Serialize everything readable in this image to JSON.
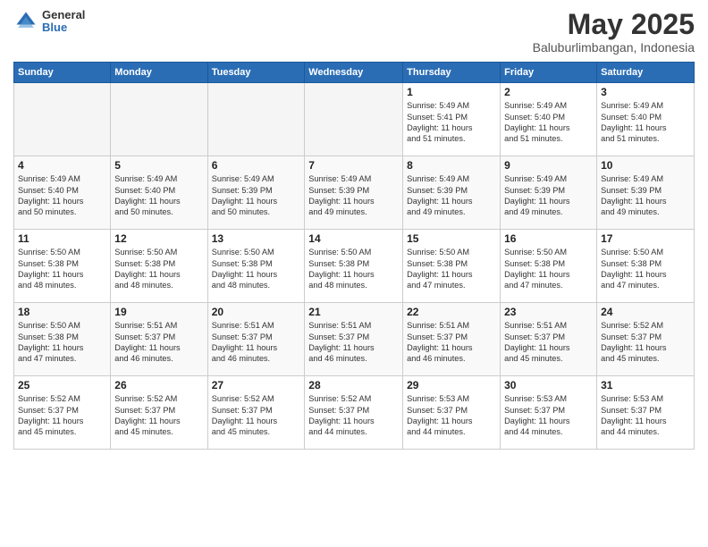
{
  "logo": {
    "general": "General",
    "blue": "Blue"
  },
  "header": {
    "month": "May 2025",
    "location": "Baluburlimbangan, Indonesia"
  },
  "weekdays": [
    "Sunday",
    "Monday",
    "Tuesday",
    "Wednesday",
    "Thursday",
    "Friday",
    "Saturday"
  ],
  "weeks": [
    [
      {
        "day": "",
        "info": ""
      },
      {
        "day": "",
        "info": ""
      },
      {
        "day": "",
        "info": ""
      },
      {
        "day": "",
        "info": ""
      },
      {
        "day": "1",
        "info": "Sunrise: 5:49 AM\nSunset: 5:41 PM\nDaylight: 11 hours\nand 51 minutes."
      },
      {
        "day": "2",
        "info": "Sunrise: 5:49 AM\nSunset: 5:40 PM\nDaylight: 11 hours\nand 51 minutes."
      },
      {
        "day": "3",
        "info": "Sunrise: 5:49 AM\nSunset: 5:40 PM\nDaylight: 11 hours\nand 51 minutes."
      }
    ],
    [
      {
        "day": "4",
        "info": "Sunrise: 5:49 AM\nSunset: 5:40 PM\nDaylight: 11 hours\nand 50 minutes."
      },
      {
        "day": "5",
        "info": "Sunrise: 5:49 AM\nSunset: 5:40 PM\nDaylight: 11 hours\nand 50 minutes."
      },
      {
        "day": "6",
        "info": "Sunrise: 5:49 AM\nSunset: 5:39 PM\nDaylight: 11 hours\nand 50 minutes."
      },
      {
        "day": "7",
        "info": "Sunrise: 5:49 AM\nSunset: 5:39 PM\nDaylight: 11 hours\nand 49 minutes."
      },
      {
        "day": "8",
        "info": "Sunrise: 5:49 AM\nSunset: 5:39 PM\nDaylight: 11 hours\nand 49 minutes."
      },
      {
        "day": "9",
        "info": "Sunrise: 5:49 AM\nSunset: 5:39 PM\nDaylight: 11 hours\nand 49 minutes."
      },
      {
        "day": "10",
        "info": "Sunrise: 5:49 AM\nSunset: 5:39 PM\nDaylight: 11 hours\nand 49 minutes."
      }
    ],
    [
      {
        "day": "11",
        "info": "Sunrise: 5:50 AM\nSunset: 5:38 PM\nDaylight: 11 hours\nand 48 minutes."
      },
      {
        "day": "12",
        "info": "Sunrise: 5:50 AM\nSunset: 5:38 PM\nDaylight: 11 hours\nand 48 minutes."
      },
      {
        "day": "13",
        "info": "Sunrise: 5:50 AM\nSunset: 5:38 PM\nDaylight: 11 hours\nand 48 minutes."
      },
      {
        "day": "14",
        "info": "Sunrise: 5:50 AM\nSunset: 5:38 PM\nDaylight: 11 hours\nand 48 minutes."
      },
      {
        "day": "15",
        "info": "Sunrise: 5:50 AM\nSunset: 5:38 PM\nDaylight: 11 hours\nand 47 minutes."
      },
      {
        "day": "16",
        "info": "Sunrise: 5:50 AM\nSunset: 5:38 PM\nDaylight: 11 hours\nand 47 minutes."
      },
      {
        "day": "17",
        "info": "Sunrise: 5:50 AM\nSunset: 5:38 PM\nDaylight: 11 hours\nand 47 minutes."
      }
    ],
    [
      {
        "day": "18",
        "info": "Sunrise: 5:50 AM\nSunset: 5:38 PM\nDaylight: 11 hours\nand 47 minutes."
      },
      {
        "day": "19",
        "info": "Sunrise: 5:51 AM\nSunset: 5:37 PM\nDaylight: 11 hours\nand 46 minutes."
      },
      {
        "day": "20",
        "info": "Sunrise: 5:51 AM\nSunset: 5:37 PM\nDaylight: 11 hours\nand 46 minutes."
      },
      {
        "day": "21",
        "info": "Sunrise: 5:51 AM\nSunset: 5:37 PM\nDaylight: 11 hours\nand 46 minutes."
      },
      {
        "day": "22",
        "info": "Sunrise: 5:51 AM\nSunset: 5:37 PM\nDaylight: 11 hours\nand 46 minutes."
      },
      {
        "day": "23",
        "info": "Sunrise: 5:51 AM\nSunset: 5:37 PM\nDaylight: 11 hours\nand 45 minutes."
      },
      {
        "day": "24",
        "info": "Sunrise: 5:52 AM\nSunset: 5:37 PM\nDaylight: 11 hours\nand 45 minutes."
      }
    ],
    [
      {
        "day": "25",
        "info": "Sunrise: 5:52 AM\nSunset: 5:37 PM\nDaylight: 11 hours\nand 45 minutes."
      },
      {
        "day": "26",
        "info": "Sunrise: 5:52 AM\nSunset: 5:37 PM\nDaylight: 11 hours\nand 45 minutes."
      },
      {
        "day": "27",
        "info": "Sunrise: 5:52 AM\nSunset: 5:37 PM\nDaylight: 11 hours\nand 45 minutes."
      },
      {
        "day": "28",
        "info": "Sunrise: 5:52 AM\nSunset: 5:37 PM\nDaylight: 11 hours\nand 44 minutes."
      },
      {
        "day": "29",
        "info": "Sunrise: 5:53 AM\nSunset: 5:37 PM\nDaylight: 11 hours\nand 44 minutes."
      },
      {
        "day": "30",
        "info": "Sunrise: 5:53 AM\nSunset: 5:37 PM\nDaylight: 11 hours\nand 44 minutes."
      },
      {
        "day": "31",
        "info": "Sunrise: 5:53 AM\nSunset: 5:37 PM\nDaylight: 11 hours\nand 44 minutes."
      }
    ]
  ]
}
